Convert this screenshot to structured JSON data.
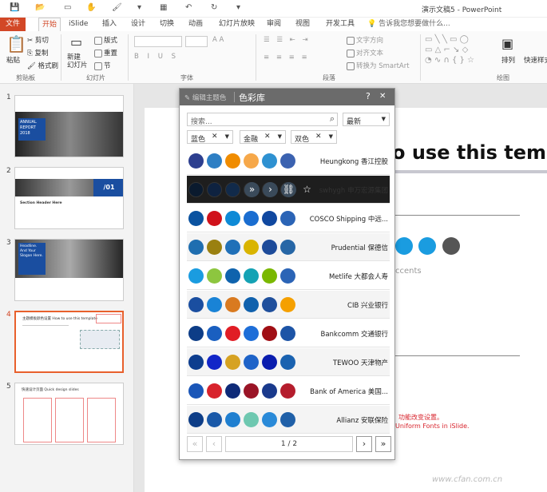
{
  "window": {
    "title": "演示文稿5 - PowerPoint"
  },
  "tabs": [
    "文件",
    "开始",
    "iSlide",
    "插入",
    "设计",
    "切换",
    "动画",
    "幻灯片放映",
    "审阅",
    "视图",
    "开发工具"
  ],
  "tell_me": "告诉我您想要做什么...",
  "ribbon": {
    "groups": {
      "clipboard": "剪贴板",
      "slides": "幻灯片",
      "font": "字体",
      "paragraph": "段落",
      "drawing": "绘图"
    },
    "paste": "粘贴",
    "cut": "剪切",
    "copy": "复制",
    "format_painter": "格式刷",
    "new_slide": "新建\n幻灯片",
    "layout": "版式",
    "reset": "重置",
    "section": "节",
    "text_direction": "文字方向",
    "align_text": "对齐文本",
    "convert_smartart": "转换为 SmartArt",
    "arrange": "排列",
    "quick_styles": "快速样式"
  },
  "slides": [
    {
      "num": "1",
      "label1": "ANNUAL",
      "label2": "REPORT",
      "label3": "2018"
    },
    {
      "num": "2",
      "label1": "/01",
      "label2": "Section Header Here"
    },
    {
      "num": "3",
      "label1": "Headline.",
      "label2": "And Your",
      "label3": "Slogan Here."
    },
    {
      "num": "4",
      "label1": "主题模板颜色设置 How to use this template"
    },
    {
      "num": "5",
      "label1": "快速设计页面 Quick design slides"
    }
  ],
  "slide_main": {
    "title": "o use this templ",
    "accents": "ccents",
    "note1": "功能改变设置。",
    "note2": "Uniform Fonts in iSlide."
  },
  "panel": {
    "edit_theme": "编辑主题色",
    "title": "色彩库",
    "help": "?",
    "close": "✕",
    "search_placeholder": "搜索...",
    "sort": "最新",
    "filter1": "蓝色",
    "filter2": "金融",
    "filter3": "双色",
    "page": "1 / 2",
    "rows": [
      {
        "label": "Heungkong 香江控股",
        "colors": [
          "#2d3f8f",
          "#2e7fc4",
          "#f08c00",
          "#f6a84a",
          "#2e91d1",
          "#3b62b0"
        ]
      },
      {
        "label": "swhygh 申万宏源集团",
        "colors": [
          "#0a1a2e",
          "#0e2240",
          "#112a4a",
          "#1d2c44",
          "#1d2c44",
          "#1d2c44"
        ],
        "dark": true
      },
      {
        "label": "COSCO Shipping 中远...",
        "colors": [
          "#0a52a0",
          "#d0121b",
          "#0e8ad6",
          "#1a6dd0",
          "#1048a0",
          "#2b64b6"
        ]
      },
      {
        "label": "Prudential 保德信",
        "colors": [
          "#1f6eb0",
          "#9a8010",
          "#2070b8",
          "#d9b400",
          "#1d4b9a",
          "#2666a6"
        ]
      },
      {
        "label": "Metlife 大都会人寿",
        "colors": [
          "#1a9ce0",
          "#8dc63f",
          "#0f63ad",
          "#14a2b4",
          "#7ab800",
          "#2b64b6"
        ]
      },
      {
        "label": "CIB 兴业银行",
        "colors": [
          "#1a4ea0",
          "#1983d6",
          "#d97a20",
          "#1061ad",
          "#1f4f9c",
          "#f5a000"
        ]
      },
      {
        "label": "Bankcomm 交通银行",
        "colors": [
          "#0d3d87",
          "#1a5fc0",
          "#e11d25",
          "#1e6ed8",
          "#a00e14",
          "#1d54a6"
        ]
      },
      {
        "label": "TEWOO 天津物产",
        "colors": [
          "#0d3d8e",
          "#1226c8",
          "#d6a222",
          "#1e63c8",
          "#0a1cae",
          "#1a62b0"
        ]
      },
      {
        "label": "Bank of America 美国...",
        "colors": [
          "#1a56b8",
          "#d8232c",
          "#0e2a78",
          "#9a1426",
          "#1a3a8c",
          "#b51d2d"
        ]
      },
      {
        "label": "Allianz 安联保险",
        "colors": [
          "#0d3d87",
          "#1a59a8",
          "#1f7fd0",
          "#6ec8b0",
          "#2a8ad8",
          "#2060a8"
        ]
      }
    ]
  },
  "watermark": "www.cfan.com.cn"
}
